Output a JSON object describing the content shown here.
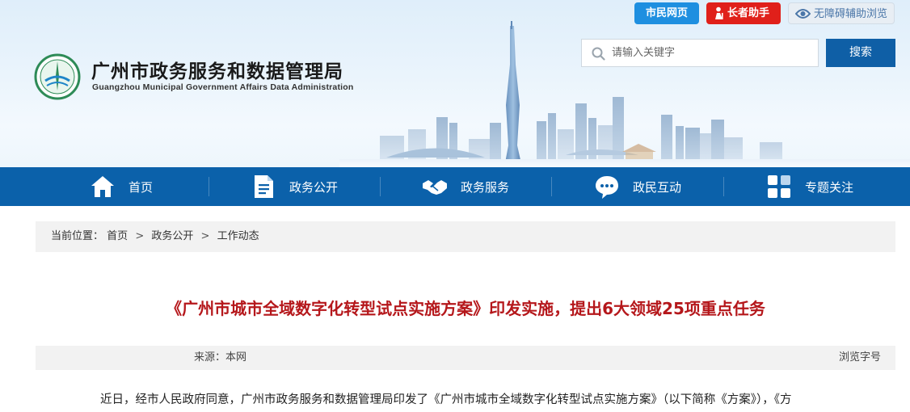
{
  "site": {
    "title": "广州市政务服务和数据管理局",
    "subtitle": "Guangzhou Municipal Government Affairs Data Administration"
  },
  "top_links": {
    "citizen": "市民网页",
    "elder": "长者助手",
    "accessibility": "无障碍辅助浏览"
  },
  "search": {
    "placeholder": "请输入关键字",
    "button": "搜索"
  },
  "nav": [
    {
      "label": "首页",
      "icon": "home-icon"
    },
    {
      "label": "政务公开",
      "icon": "document-icon"
    },
    {
      "label": "政务服务",
      "icon": "handshake-icon"
    },
    {
      "label": "政民互动",
      "icon": "chat-icon"
    },
    {
      "label": "专题关注",
      "icon": "grid-icon"
    }
  ],
  "breadcrumb": {
    "prefix": "当前位置：",
    "items": [
      "首页",
      "政务公开",
      "工作动态"
    ],
    "separator": ">"
  },
  "article": {
    "title": "《广州市城市全域数字化转型试点实施方案》印发实施，提出6大领域25项重点任务",
    "source": "来源：本网",
    "views_label": "浏览字号",
    "body_first_line": "近日，经市人民政府同意，广州市政务服务和数据管理局印发了《广州市城市全域数字化转型试点实施方案》（以下简称《方案》），《方"
  },
  "colors": {
    "nav_bg": "#0b61aa",
    "title_red": "#b5171b",
    "citizen_btn": "#1e8fe0",
    "elder_btn": "#e0201a",
    "search_btn": "#0f5fa6"
  }
}
